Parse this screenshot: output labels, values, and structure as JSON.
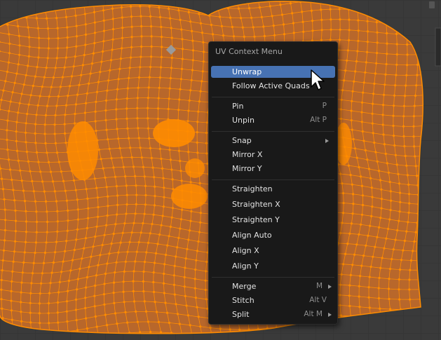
{
  "menu": {
    "title": "UV Context Menu",
    "items": [
      {
        "label": "Unwrap",
        "shortcut": ""
      },
      {
        "label": "Follow Active Quads",
        "shortcut": ""
      },
      {
        "label": "Pin",
        "shortcut": "P"
      },
      {
        "label": "Unpin",
        "shortcut": "Alt P"
      },
      {
        "label": "Snap",
        "shortcut": ""
      },
      {
        "label": "Mirror X",
        "shortcut": ""
      },
      {
        "label": "Mirror Y",
        "shortcut": ""
      },
      {
        "label": "Straighten",
        "shortcut": ""
      },
      {
        "label": "Straighten X",
        "shortcut": ""
      },
      {
        "label": "Straighten Y",
        "shortcut": ""
      },
      {
        "label": "Align Auto",
        "shortcut": ""
      },
      {
        "label": "Align X",
        "shortcut": ""
      },
      {
        "label": "Align Y",
        "shortcut": ""
      },
      {
        "label": "Merge",
        "shortcut": "M"
      },
      {
        "label": "Stitch",
        "shortcut": "Alt V"
      },
      {
        "label": "Split",
        "shortcut": "Alt M"
      }
    ]
  },
  "colors": {
    "background": "#3a3a3a",
    "mesh_fill": "#b8672b",
    "mesh_edge": "#ff8c00",
    "menu_bg": "#191919",
    "highlight": "#4772b3"
  }
}
